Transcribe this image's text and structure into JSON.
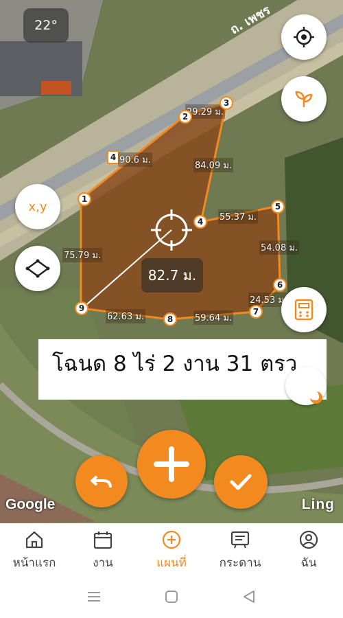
{
  "status": {
    "temperature": "22°"
  },
  "map": {
    "road_label": "ถ. เพชร",
    "distance_readout": "82.7 ม.",
    "segments": [
      {
        "label": "29.29 ม."
      },
      {
        "label": "84.09 ม."
      },
      {
        "label": "90.6 ม."
      },
      {
        "label": "55.37 ม."
      },
      {
        "label": "54.08 ม."
      },
      {
        "label": "75.79 ม."
      },
      {
        "label": "24.53 ม."
      },
      {
        "label": "62.63 ม."
      },
      {
        "label": "59.64 ม."
      }
    ],
    "vertices": [
      "1",
      "2",
      "3",
      "4",
      "5",
      "6",
      "7",
      "8",
      "9"
    ],
    "highway_shield": "4",
    "deed_text": "โฉนด 8 ไร่ 2 งาน 31 ตรว.",
    "google_tag": "Google",
    "provider_tag": "Ling"
  },
  "buttons": {
    "xy_label": "x,y",
    "locate_icon": "crosshair-icon",
    "plant_icon": "sprout-icon",
    "polygon_icon": "polygon-icon",
    "calculator_icon": "calculator-icon",
    "undo_icon": "undo-icon",
    "add_icon": "plus-icon",
    "confirm_icon": "check-icon"
  },
  "nav": {
    "items": [
      {
        "label": "หน้าแรก",
        "icon": "home-icon"
      },
      {
        "label": "งาน",
        "icon": "calendar-icon"
      },
      {
        "label": "แผนที่",
        "icon": "map-plus-icon"
      },
      {
        "label": "กระดาน",
        "icon": "board-icon"
      },
      {
        "label": "ฉัน",
        "icon": "user-icon"
      }
    ],
    "active_index": 2
  },
  "colors": {
    "accent": "#f28a20",
    "parcel_fill": "#8a4b1e"
  }
}
